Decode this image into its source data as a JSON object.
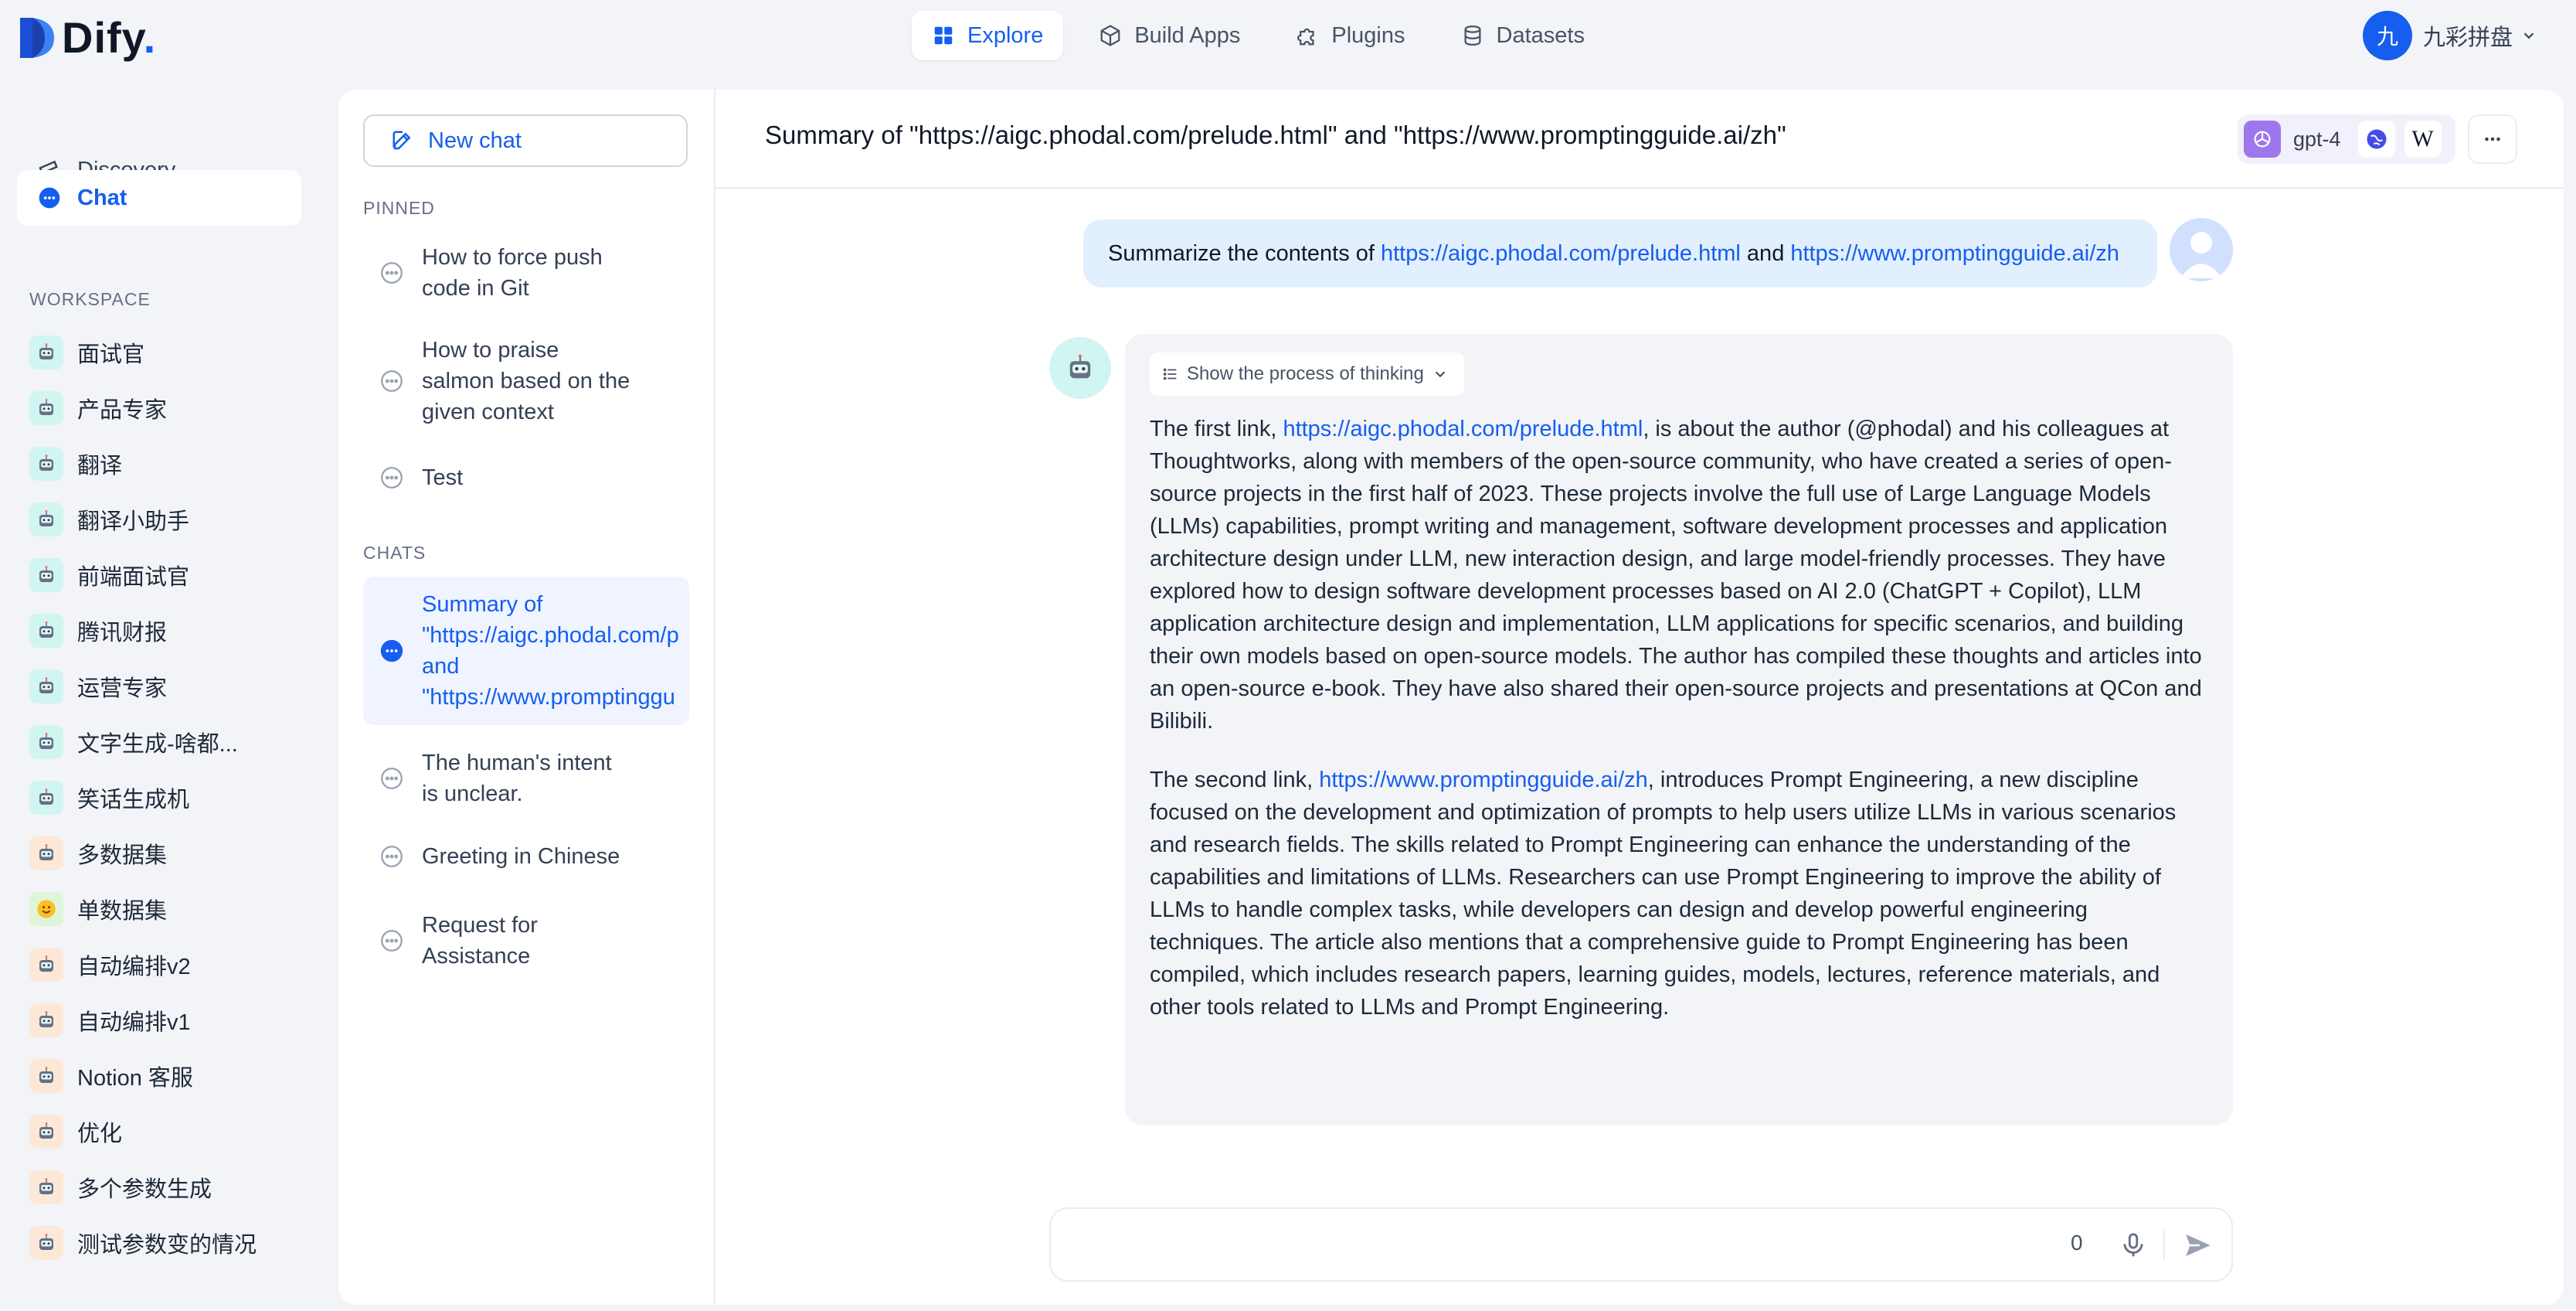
{
  "app": {
    "logo_text": "Dify",
    "logo_dot": "."
  },
  "nav": {
    "items": [
      {
        "label": "Explore",
        "icon": "grid-icon",
        "active": true
      },
      {
        "label": "Build Apps",
        "icon": "cube-icon",
        "active": false
      },
      {
        "label": "Plugins",
        "icon": "puzzle-icon",
        "active": false
      },
      {
        "label": "Datasets",
        "icon": "database-icon",
        "active": false
      }
    ]
  },
  "user": {
    "avatar_initial": "九",
    "name": "九彩拼盘"
  },
  "left": {
    "discovery": "Discovery",
    "chat": "Chat",
    "workspace_title": "WORKSPACE",
    "workspace_items": [
      "面试官",
      "产品专家",
      "翻译",
      "翻译小助手",
      "前端面试官",
      "腾讯财报",
      "运营专家",
      "文字生成-啥都...",
      "笑话生成机",
      "多数据集",
      "单数据集",
      "自动编排v2",
      "自动编排v1",
      "Notion 客服",
      "优化",
      "多个参数生成",
      "测试参数变的情况"
    ]
  },
  "chat_list": {
    "new_chat": "New chat",
    "pinned_label": "PINNED",
    "pinned": [
      "How to force push\ncode in Git",
      "How to praise\nsalmon based on the\ngiven context",
      "Test"
    ],
    "chats_label": "CHATS",
    "active_chat": "Summary of\n\"https://aigc.phodal.com/p\nand\n\"https://www.promptinggu",
    "chats": [
      "The human's intent\nis unclear.",
      "Greeting in Chinese",
      "Request for\nAssistance"
    ]
  },
  "conversation": {
    "title": "Summary of \"https://aigc.phodal.com/prelude.html\" and \"https://www.promptingguide.ai/zh\"",
    "model": "gpt-4",
    "user_message": {
      "prefix": "Summarize the contents of ",
      "link1": "https://aigc.phodal.com/prelude.html",
      "middle": " and ",
      "link2": "https://www.promptingguide.ai/zh"
    },
    "think_toggle": "Show the process of thinking",
    "reply_p1": {
      "prefix": "The first link, ",
      "link": "https://aigc.phodal.com/prelude.html",
      "body": ", is about the author (@phodal) and his colleagues at Thoughtworks, along with members of the open-source community, who have created a series of open-source projects in the first half of 2023. These projects involve the full use of Large Language Models (LLMs) capabilities, prompt writing and management, software development processes and application architecture design under LLM, new interaction design, and large model-friendly processes. They have explored how to design software development processes based on AI 2.0 (ChatGPT + Copilot), LLM application architecture design and implementation, LLM applications for specific scenarios, and building their own models based on open-source models. The author has compiled these thoughts and articles into an open-source e-book. They have also shared their open-source projects and presentations at QCon and Bilibili."
    },
    "reply_p2": {
      "prefix": "The second link, ",
      "link": "https://www.promptingguide.ai/zh",
      "body": ", introduces Prompt Engineering, a new discipline focused on the development and optimization of prompts to help users utilize LLMs in various scenarios and research fields. The skills related to Prompt Engineering can enhance the understanding of the capabilities and limitations of LLMs. Researchers can use Prompt Engineering to improve the ability of LLMs to handle complex tasks, while developers can design and develop powerful engineering techniques. The article also mentions that a comprehensive guide to Prompt Engineering has been compiled, which includes research papers, learning guides, models, lectures, reference materials, and other tools related to LLMs and Prompt Engineering."
    },
    "input": {
      "value": "",
      "char_count": "0"
    }
  },
  "colors": {
    "accent": "#155eef",
    "active_bg": "#eff4ff",
    "user_bubble": "#e1effe",
    "bot_bubble": "#f2f4f7"
  }
}
